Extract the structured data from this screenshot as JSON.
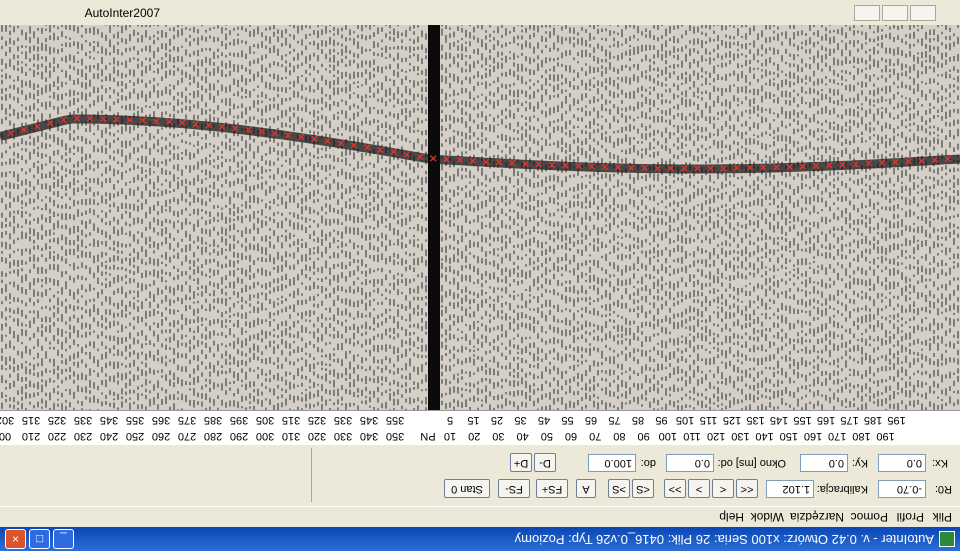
{
  "window": {
    "title": "AutoInter - v. 0.42 Otwórz: x100 Seria: 26 Plik: 0416_0.v26 Typ: Poziomy",
    "min_label": "_",
    "max_label": "□",
    "close_label": "×",
    "inner_title": "AutoInter2007"
  },
  "menu": {
    "items": [
      "Plik",
      "Profil",
      "Pomoc",
      "Narzędzia",
      "Widok",
      "Help"
    ]
  },
  "controls": {
    "kx_label": "Kx:",
    "kx_value": "0.0",
    "ky_label": "Ky:",
    "ky_value": "0.0",
    "okno_label": "Okno [ms] od:",
    "okno_from": "0.0",
    "do_label": "do:",
    "okno_to": "100.0",
    "d_minus": "D-",
    "d_plus": "D+",
    "r0_label": "R0:",
    "r0_value": "-0.70",
    "kal_label": "Kalibracja:",
    "kal_value": "1.102",
    "nav_first": "<<",
    "nav_prev": "<",
    "nav_next": ">",
    "nav_last": ">>",
    "s_minus": "<S",
    "s_plus": ">S",
    "a_btn": "A",
    "fs_plus": "FS+",
    "fs_minus": "FS-",
    "stan_label": "Stan 0"
  },
  "ruler": {
    "left_labels": [
      "00",
      "210",
      "220",
      "230",
      "240",
      "250",
      "260",
      "270",
      "280",
      "290",
      "300",
      "310",
      "320",
      "330",
      "340",
      "350"
    ],
    "center_label": "PN",
    "right_labels": [
      "10",
      "20",
      "30",
      "40",
      "50",
      "60",
      "70",
      "80",
      "90",
      "100",
      "110",
      "120",
      "130",
      "140",
      "150",
      "160",
      "170",
      "180",
      "190"
    ],
    "top_left_labels": [
      "302",
      "315",
      "325",
      "335",
      "345",
      "355",
      "365",
      "375",
      "385",
      "395",
      "305",
      "315",
      "325",
      "335",
      "345",
      "355"
    ],
    "top_right_labels": [
      "5",
      "15",
      "25",
      "35",
      "45",
      "55",
      "65",
      "75",
      "85",
      "95",
      "105",
      "115",
      "125",
      "135",
      "145",
      "155",
      "165",
      "175",
      "185",
      "195"
    ]
  },
  "colors": {
    "pick_marker": "#e8352a",
    "horizon_band": "#1a1a1a",
    "center_trace": "#0b0b0b",
    "title_bar": "#0a46b4"
  }
}
